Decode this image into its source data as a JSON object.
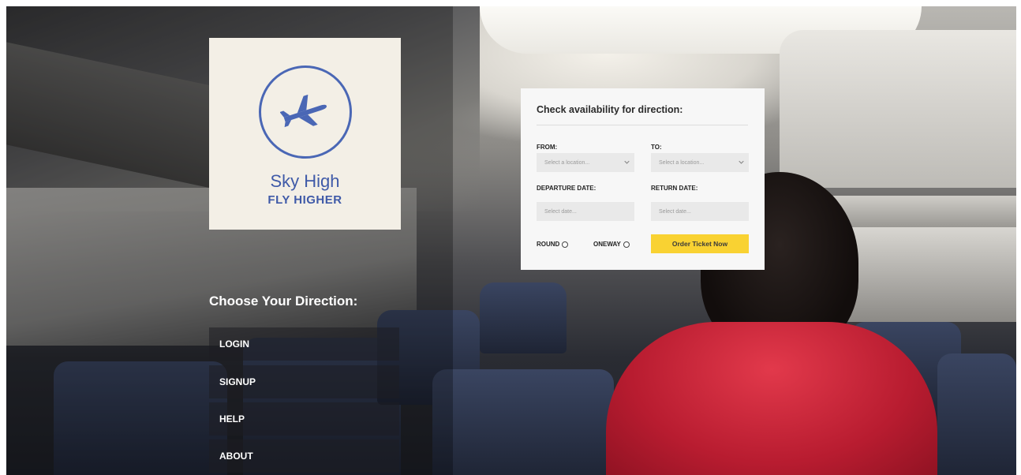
{
  "brand": {
    "name": "Sky High",
    "tagline": "FLY HIGHER",
    "accent_color": "#4a67b5",
    "logo_icon": "airplane-icon"
  },
  "directions": {
    "title": "Choose Your Direction:",
    "items": [
      {
        "label": "LOGIN"
      },
      {
        "label": "SIGNUP"
      },
      {
        "label": "HELP"
      },
      {
        "label": "ABOUT"
      }
    ]
  },
  "booking": {
    "title": "Check availability for direction:",
    "from": {
      "label": "FROM:",
      "placeholder": "Select a location..."
    },
    "to": {
      "label": "TO:",
      "placeholder": "Select a location..."
    },
    "departure": {
      "label": "DEPARTURE DATE:",
      "placeholder": "Select date..."
    },
    "return": {
      "label": "RETURN DATE:",
      "placeholder": "Select date..."
    },
    "trip_types": [
      {
        "label": "ROUND",
        "selected": false
      },
      {
        "label": "ONEWAY",
        "selected": false
      }
    ],
    "submit_label": "Order Ticket Now",
    "submit_color": "#f9d232"
  }
}
